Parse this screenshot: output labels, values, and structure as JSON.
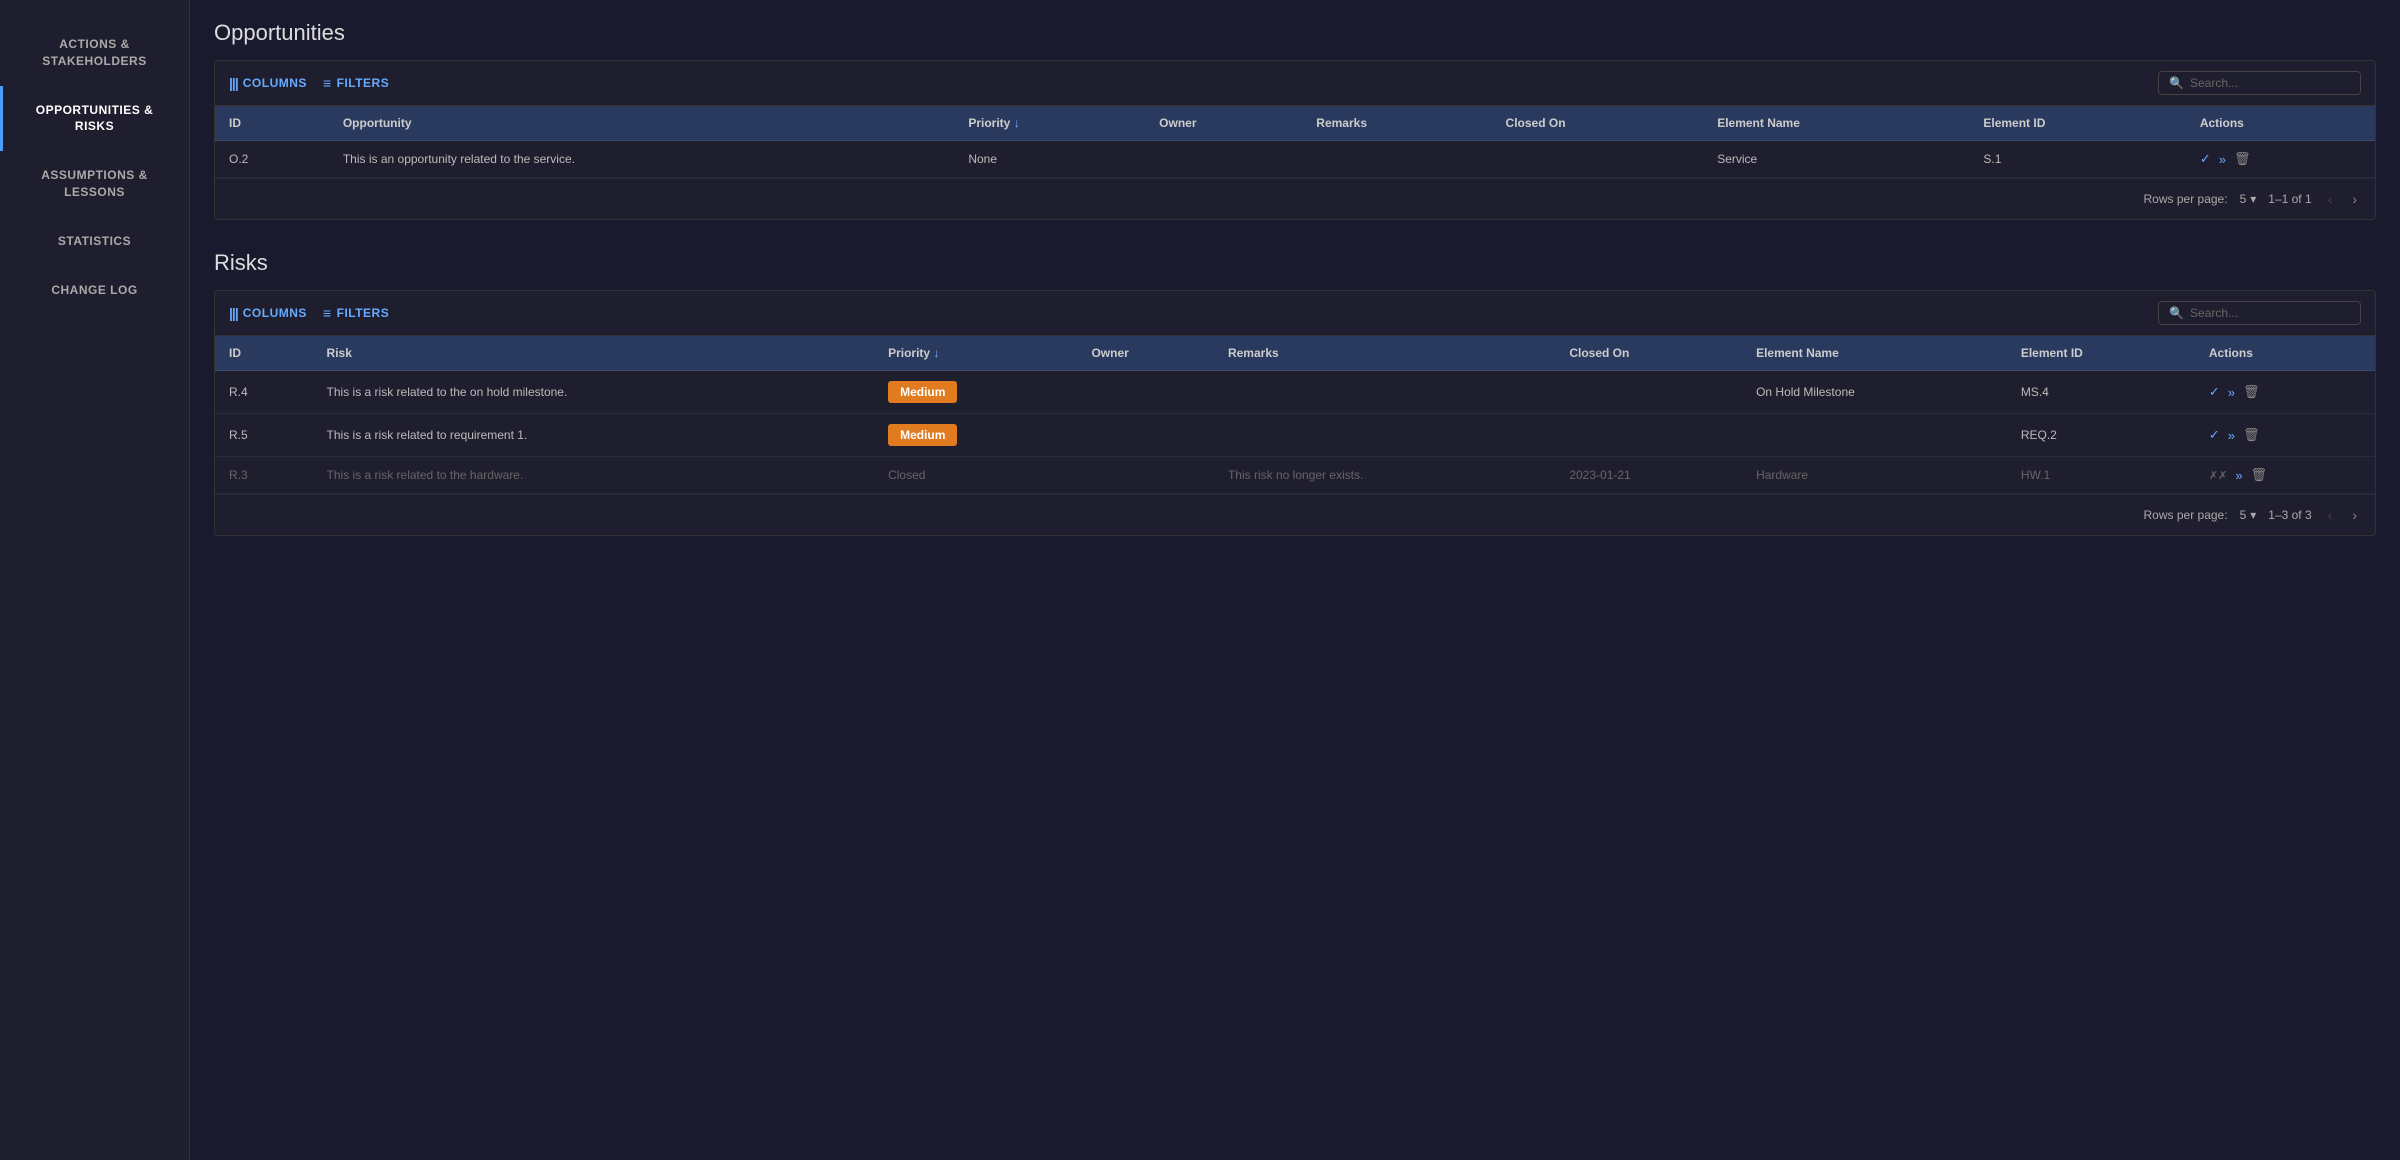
{
  "sidebar": {
    "items": [
      {
        "id": "actions-stakeholders",
        "label": "ACTIONS &\nSTAKEHOLDERS",
        "active": false
      },
      {
        "id": "opportunities-risks",
        "label": "OPPORTUNITIES &\nRISKS",
        "active": true
      },
      {
        "id": "assumptions-lessons",
        "label": "ASSUMPTIONS &\nLESSONS",
        "active": false
      },
      {
        "id": "statistics",
        "label": "STATISTICS",
        "active": false
      },
      {
        "id": "change-log",
        "label": "CHANGE LOG",
        "active": false
      }
    ]
  },
  "opportunities": {
    "title": "Opportunities",
    "toolbar": {
      "columns_label": "COLUMNS",
      "filters_label": "FILTERS",
      "search_placeholder": "Search..."
    },
    "table": {
      "columns": [
        {
          "id": "id",
          "label": "ID",
          "sortable": false
        },
        {
          "id": "opportunity",
          "label": "Opportunity",
          "sortable": false
        },
        {
          "id": "priority",
          "label": "Priority",
          "sortable": true
        },
        {
          "id": "owner",
          "label": "Owner",
          "sortable": false
        },
        {
          "id": "remarks",
          "label": "Remarks",
          "sortable": false
        },
        {
          "id": "closed_on",
          "label": "Closed On",
          "sortable": false
        },
        {
          "id": "element_name",
          "label": "Element Name",
          "sortable": false
        },
        {
          "id": "element_id",
          "label": "Element ID",
          "sortable": false
        },
        {
          "id": "actions",
          "label": "Actions",
          "sortable": false
        }
      ],
      "rows": [
        {
          "id": "O.2",
          "opportunity": "This is an opportunity related to the service.",
          "priority": "None",
          "priority_type": "none",
          "owner": "",
          "remarks": "",
          "closed_on": "",
          "element_name": "Service",
          "element_id": "S.1",
          "closed": false
        }
      ]
    },
    "pagination": {
      "rows_per_page_label": "Rows per page:",
      "rows_per_page_value": "5",
      "page_info": "1–1 of 1"
    }
  },
  "risks": {
    "title": "Risks",
    "toolbar": {
      "columns_label": "COLUMNS",
      "filters_label": "FILTERS",
      "search_placeholder": "Search..."
    },
    "table": {
      "columns": [
        {
          "id": "id",
          "label": "ID",
          "sortable": false
        },
        {
          "id": "risk",
          "label": "Risk",
          "sortable": false
        },
        {
          "id": "priority",
          "label": "Priority",
          "sortable": true
        },
        {
          "id": "owner",
          "label": "Owner",
          "sortable": false
        },
        {
          "id": "remarks",
          "label": "Remarks",
          "sortable": false
        },
        {
          "id": "closed_on",
          "label": "Closed On",
          "sortable": false
        },
        {
          "id": "element_name",
          "label": "Element Name",
          "sortable": false
        },
        {
          "id": "element_id",
          "label": "Element ID",
          "sortable": false
        },
        {
          "id": "actions",
          "label": "Actions",
          "sortable": false
        }
      ],
      "rows": [
        {
          "id": "R.4",
          "risk": "This is a risk related to the on hold milestone.",
          "priority": "Medium",
          "priority_type": "medium",
          "owner": "",
          "remarks": "",
          "closed_on": "",
          "element_name": "On Hold Milestone",
          "element_id": "MS.4",
          "closed": false
        },
        {
          "id": "R.5",
          "risk": "This is a risk related to requirement 1.",
          "priority": "Medium",
          "priority_type": "medium",
          "owner": "",
          "remarks": "",
          "closed_on": "",
          "element_name": "",
          "element_id": "REQ.2",
          "closed": false
        },
        {
          "id": "R.3",
          "risk": "This is a risk related to the hardware.",
          "priority": "Closed",
          "priority_type": "closed",
          "owner": "",
          "remarks": "This risk no longer exists.",
          "closed_on": "2023-01-21",
          "element_name": "Hardware",
          "element_id": "HW.1",
          "closed": true
        }
      ]
    },
    "pagination": {
      "rows_per_page_label": "Rows per page:",
      "rows_per_page_value": "5",
      "page_info": "1–3 of 3"
    }
  },
  "icons": {
    "columns": "|||",
    "filters": "≡",
    "search": "🔍",
    "sort_down": "↓",
    "check": "✓",
    "double_arrow": "»",
    "delete": "🗑",
    "crossed_check": "✗",
    "chevron_left": "‹",
    "chevron_right": "›",
    "chevron_down": "▾"
  }
}
